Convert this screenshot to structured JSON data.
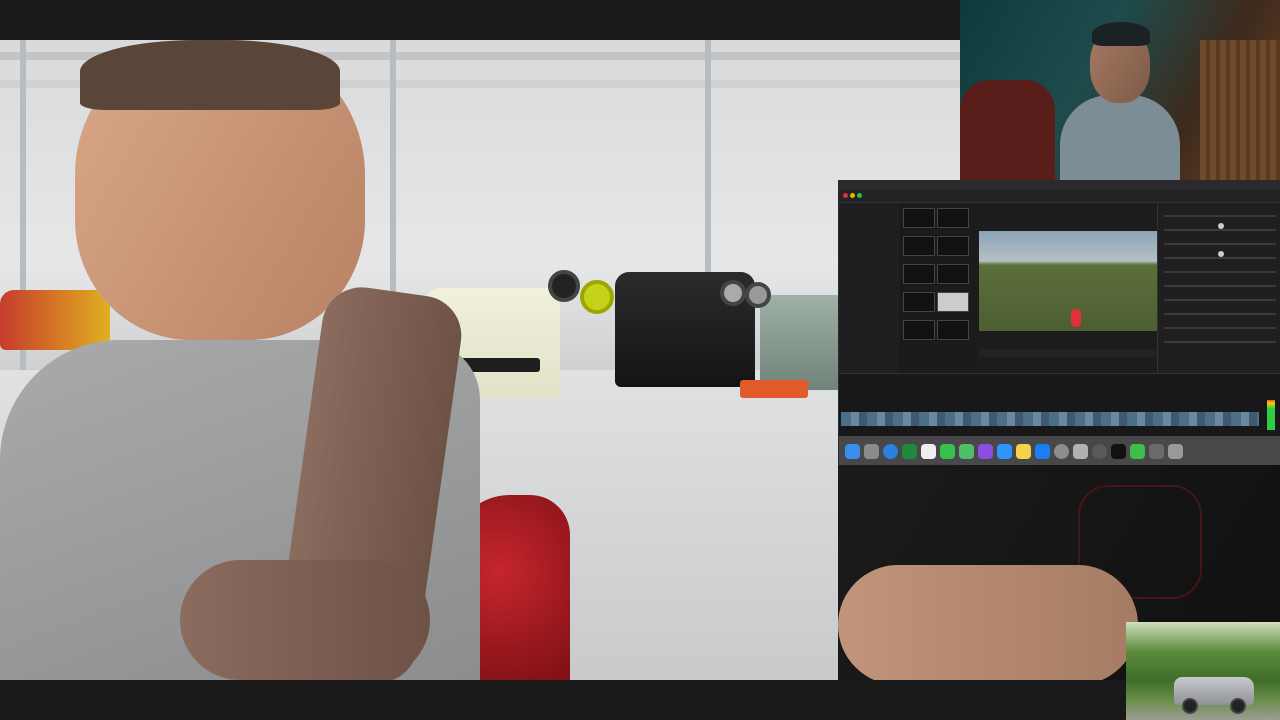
{
  "editor": {
    "menubar": [],
    "toolbar": {},
    "dock_icons": [
      "finder-icon",
      "launchpad-icon",
      "safari-icon",
      "facetime-icon",
      "calendar-icon",
      "messages-icon",
      "maps-icon",
      "photos-icon",
      "notes-icon",
      "files-icon",
      "appstore-icon",
      "settings-icon",
      "numbers-icon",
      "quicktime-icon",
      "tv-icon",
      "music-icon",
      "folder-icon",
      "trash-icon"
    ]
  },
  "colors": {
    "background": "#1a1a1a",
    "editor_bg": "#1c1c1e",
    "clip_blue": "#4b6e89",
    "meter_green": "#2ecc40",
    "red_marker": "#e0303a"
  }
}
